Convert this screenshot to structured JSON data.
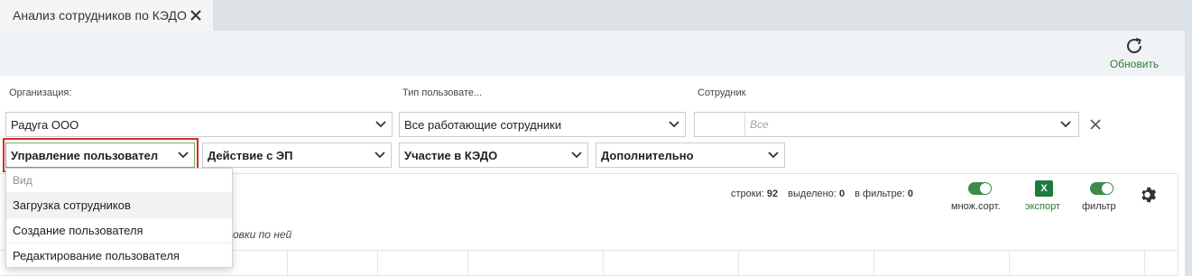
{
  "tab": {
    "title": "Анализ сотрудников по КЭДО"
  },
  "toolbar": {
    "refresh_label": "Обновить"
  },
  "filters": {
    "organization": {
      "label": "Организация:",
      "value": "Радуга ООО"
    },
    "user_type": {
      "label": "Тип пользовате...",
      "value": "Все работающие сотрудники"
    },
    "employee": {
      "label": "Сотрудник",
      "placeholder": "Все"
    }
  },
  "views": [
    {
      "label": "Управление пользовател"
    },
    {
      "label": "Действие с ЭП"
    },
    {
      "label": "Участие в КЭДО"
    },
    {
      "label": "Дополнительно"
    }
  ],
  "dropdown": {
    "group": "Вид",
    "items": [
      {
        "label": "Загрузка сотрудников"
      },
      {
        "label": "Создание пользователя"
      },
      {
        "label": "Редактирование пользователя"
      }
    ]
  },
  "grid": {
    "stats": {
      "rows_label": "строки:",
      "rows_value": "92",
      "selected_label": "выделено:",
      "selected_value": "0",
      "filter_label": "в фильтре:",
      "filter_value": "0"
    },
    "multisort_label": "множ.сорт.",
    "export_label": "экспорт",
    "export_icon_text": "X",
    "filter_label": "фильтр",
    "group_hint": "овки по ней"
  },
  "colors": {
    "accent": "#3c8b4a",
    "highlight": "#d32f2f",
    "excel": "#1f7a3e"
  }
}
